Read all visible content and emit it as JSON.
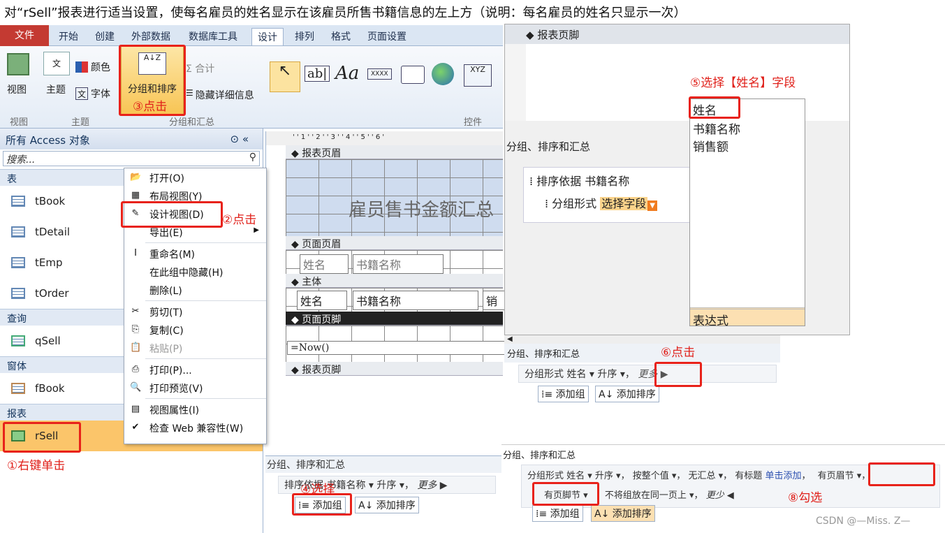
{
  "question": "对“rSell”报表进行适当设置，使每名雇员的姓名显示在该雇员所售书籍信息的左上方（说明：每名雇员的姓名只显示一次）",
  "tabs": {
    "file": "文件",
    "items": [
      "开始",
      "创建",
      "外部数据",
      "数据库工具",
      "设计",
      "排列",
      "格式",
      "页面设置"
    ]
  },
  "ribbon": {
    "view": "视图",
    "theme": "主题",
    "color": "颜色",
    "font": "字体",
    "group_sort": "分组和排序",
    "total": "Σ 合计",
    "hide_detail": "隐藏详细信息",
    "g_view": "视图",
    "g_theme": "主题",
    "g_group": "分组和汇总",
    "g_controls": "控件",
    "ab": "ab|",
    "aa": "Aa",
    "xxxx": "XXXX",
    "xyz": "XYZ"
  },
  "nav": {
    "title": "所有 Access 对象",
    "search": "搜索...",
    "cat_table": "表",
    "tables": [
      "tBook",
      "tDetail",
      "tEmp",
      "tOrder"
    ],
    "cat_query": "查询",
    "query": "qSell",
    "cat_form": "窗体",
    "form": "fBook",
    "cat_report": "报表",
    "report": "rSell"
  },
  "ctx": {
    "open": "打开(O)",
    "layout": "布局视图(Y)",
    "design": "设计视图(D)",
    "export": "导出(E)",
    "rename": "重命名(M)",
    "hide": "在此组中隐藏(H)",
    "delete": "删除(L)",
    "cut": "剪切(T)",
    "copy": "复制(C)",
    "paste": "粘贴(P)",
    "print": "打印(P)...",
    "preview": "打印预览(V)",
    "props": "视图属性(I)",
    "webcheck": "检查 Web 兼容性(W)"
  },
  "design": {
    "ruler": "' ' 1 ' ' 2 ' ' 3 ' ' 4 ' ' 5 ' ' 6 '",
    "report_header": "报表页眉",
    "title": "雇员售书金额汇总",
    "page_header": "页面页眉",
    "name": "姓名",
    "book": "书籍名称",
    "main": "主体",
    "sale": "销",
    "page_footer": "页面页脚",
    "now": "=Now()",
    "report_footer": "报表页脚"
  },
  "gsp1": {
    "title": "分组、排序和汇总",
    "line": "排序依据 书籍名称 ▾ 升序 ▾，",
    "more": "更多 ▶",
    "add_group": "添加组",
    "add_sort": "添加排序"
  },
  "panel2": {
    "footer_title": "报表页脚",
    "gsp_title": "分组、排序和汇总",
    "sort": "排序依据 书籍名称",
    "groupby": "分组形式",
    "select_field": "选择字段",
    "fields": [
      "姓名",
      "书籍名称",
      "销售额"
    ],
    "expr": "表达式"
  },
  "panel3": {
    "title": "分组、排序和汇总",
    "line": "分组形式 姓名 ▾  升序 ▾，",
    "more": "更多 ▶",
    "add_group": "添加组",
    "add_sort": "添加排序"
  },
  "panel4": {
    "title": "分组、排序和汇总",
    "line1a": "分组形式 姓名 ▾  升序 ▾，  按整个值 ▾，  无汇总 ▾，  有标题",
    "line1b": "单击添加",
    "line1c": "，",
    "header_opt": "有页眉节 ▾，",
    "footer_opt": "有页脚节 ▾",
    "line2": "不将组放在同一页上 ▾，",
    "less": "更少 ◀",
    "add_group": "添加组",
    "add_sort": "添加排序"
  },
  "annotations": {
    "a1": "①右键单击",
    "a2": "②点击",
    "a3": "③点击",
    "a4": "④选择",
    "a5": "⑤选择【姓名】字段",
    "a6": "⑥点击",
    "a8": "⑧勾选"
  },
  "watermark": "CSDN @—Miss. Z—",
  "colors": {
    "red": "#e8221a",
    "ribbon_blue": "#dbe6f3",
    "highlight": "#fbd38b"
  }
}
